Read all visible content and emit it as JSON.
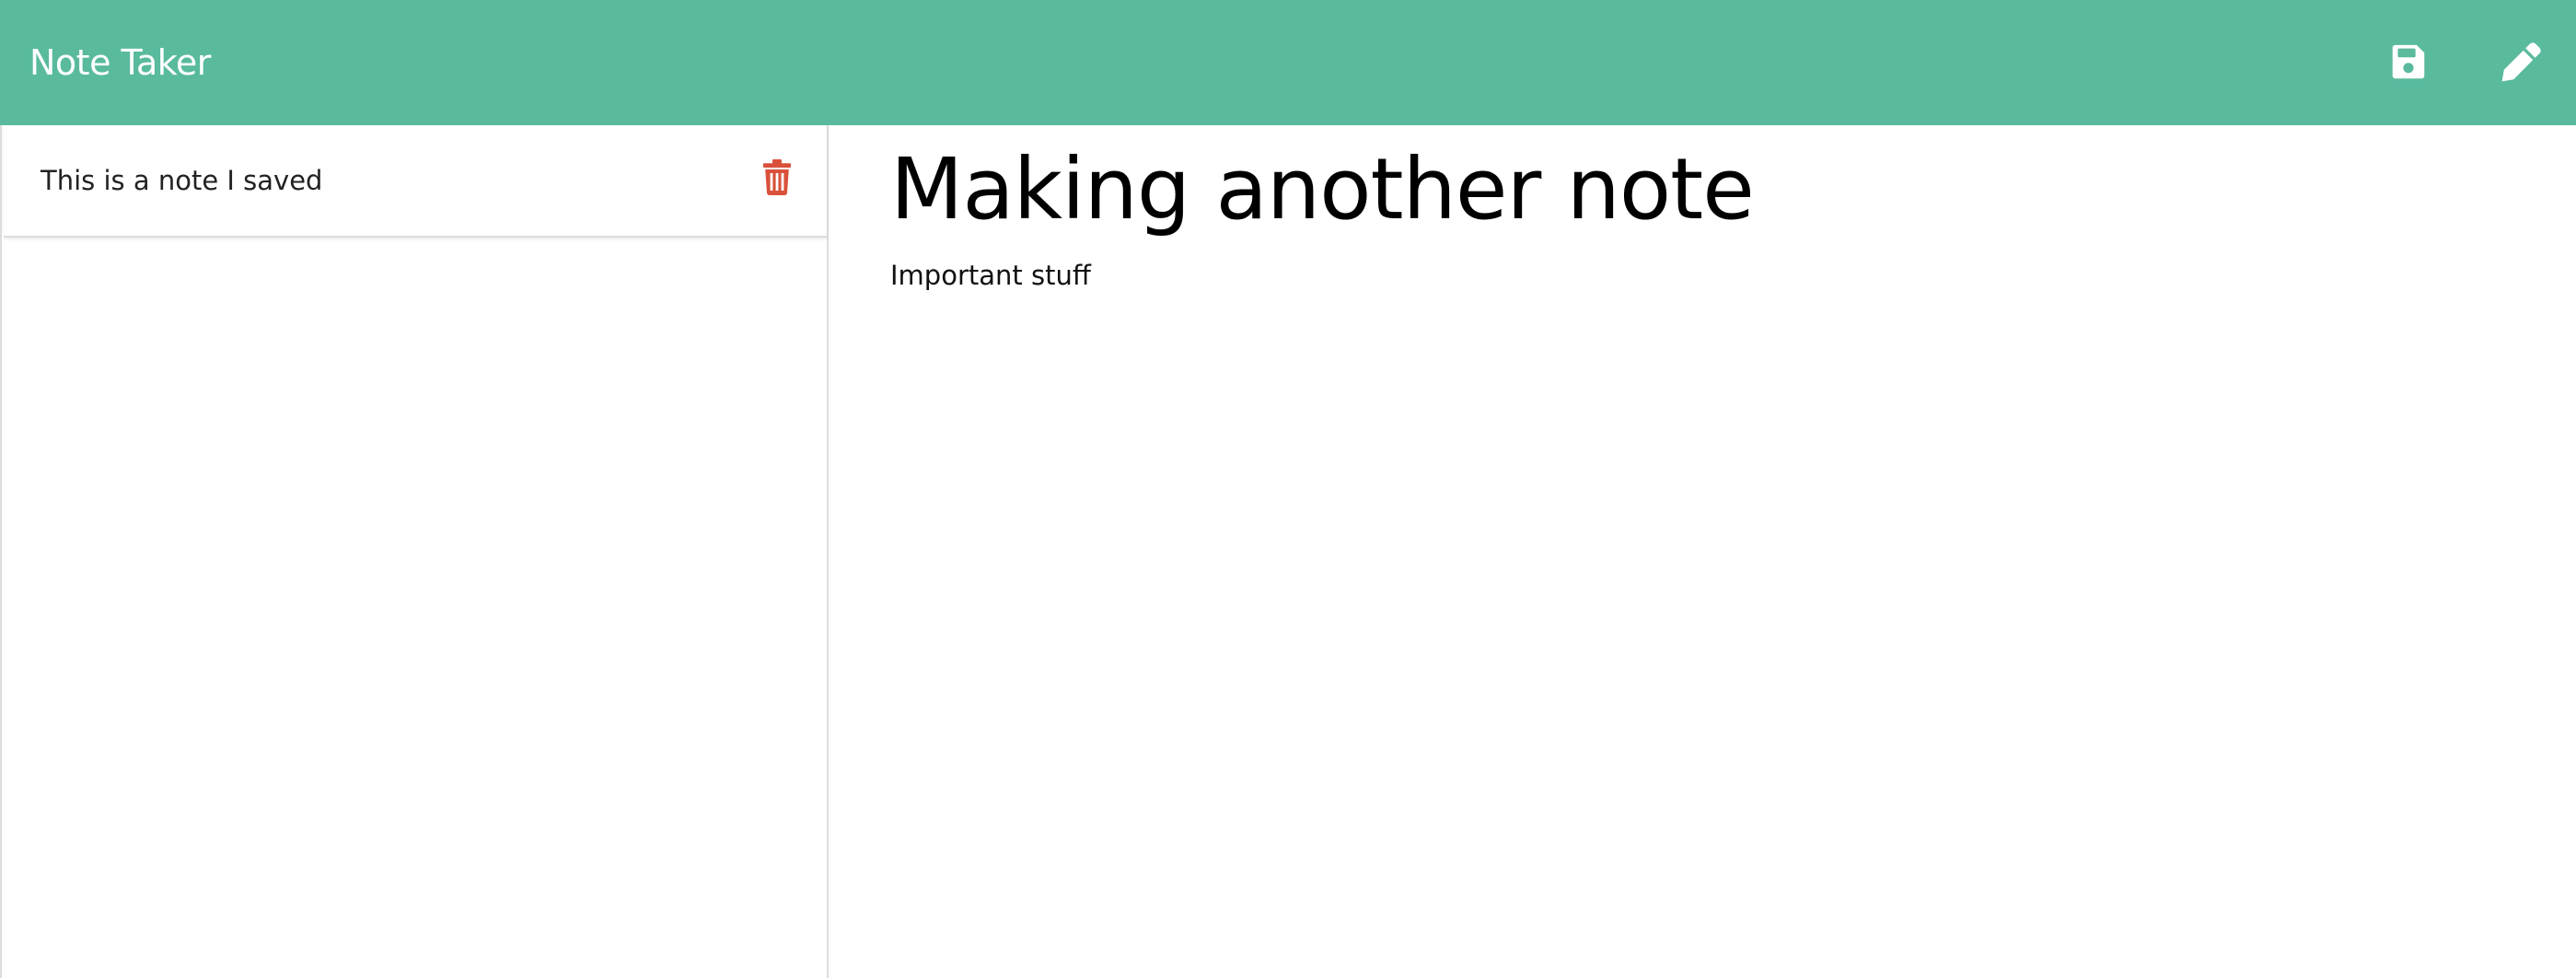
{
  "app": {
    "title": "Note Taker"
  },
  "colors": {
    "header_bg": "#59BA9E",
    "delete_icon": "#D9513B",
    "header_icons": "#FFFFFF"
  },
  "header": {
    "icons": [
      "save-icon",
      "pencil-icon"
    ]
  },
  "sidebar": {
    "notes": [
      {
        "title": "This is a note I saved",
        "icon": "trash-icon"
      }
    ]
  },
  "active_note": {
    "title": "Making another note",
    "text": "Important stuff"
  }
}
